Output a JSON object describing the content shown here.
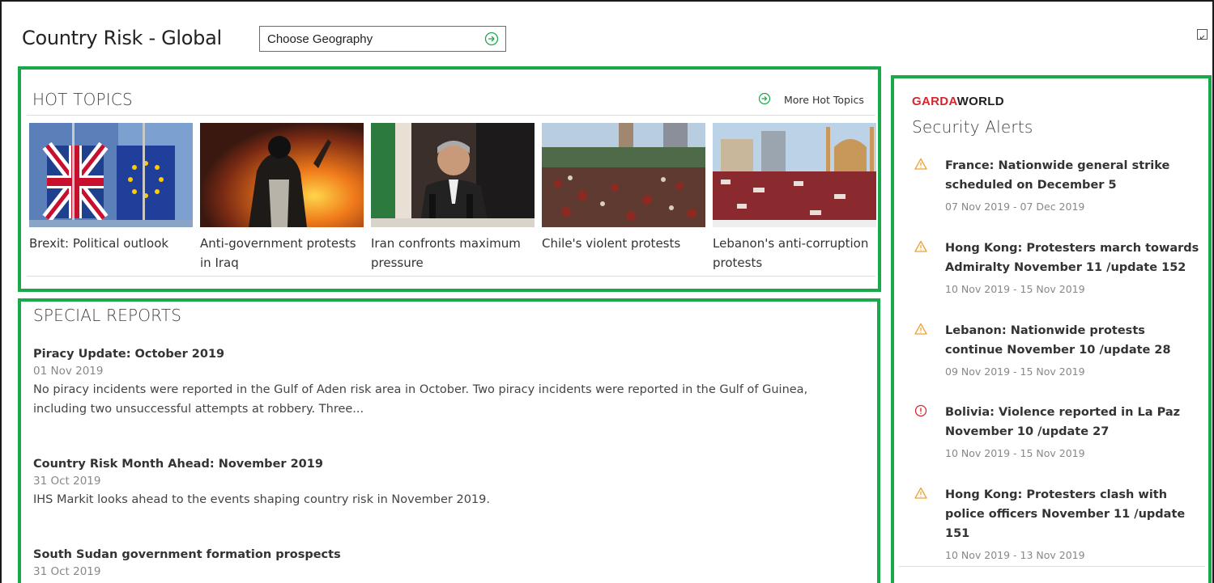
{
  "header": {
    "title": "Country Risk - Global",
    "geography_select": "Choose Geography"
  },
  "hot_topics": {
    "title": "HOT TOPICS",
    "more_link": "More Hot Topics",
    "items": [
      {
        "caption": "Brexit: Political outlook",
        "image": "uk-eu-flags"
      },
      {
        "caption": "Anti-government protests in Iraq",
        "image": "protester-with-fire"
      },
      {
        "caption": "Iran confronts maximum pressure",
        "image": "speaker-at-podium"
      },
      {
        "caption": "Chile's violent protests",
        "image": "crowd-in-plaza"
      },
      {
        "caption": "Lebanon's anti-corruption protests",
        "image": "crowd-with-mosque"
      }
    ]
  },
  "special_reports": {
    "title": "SPECIAL REPORTS",
    "items": [
      {
        "title": "Piracy Update: October 2019",
        "date": "01 Nov 2019",
        "summary": "No piracy incidents were reported in the Gulf of Aden risk area in October. Two piracy incidents were reported in the Gulf of Guinea, including two unsuccessful attempts at robbery. Three..."
      },
      {
        "title": "Country Risk Month Ahead: November 2019",
        "date": "31 Oct 2019",
        "summary": "IHS Markit looks ahead to the events shaping country risk in November 2019."
      },
      {
        "title": "South Sudan government formation prospects",
        "date": "31 Oct 2019",
        "summary": ""
      }
    ]
  },
  "security_alerts": {
    "logo_part1": "GARDA",
    "logo_part2": "WORLD",
    "title": "Security Alerts",
    "items": [
      {
        "title": "France: Nationwide general strike scheduled on December 5",
        "dates": "07 Nov 2019 - 07 Dec 2019",
        "severity": "warning"
      },
      {
        "title": "Hong Kong: Protesters march towards Admiralty November 11 /update 152",
        "dates": "10 Nov 2019 - 15 Nov 2019",
        "severity": "warning"
      },
      {
        "title": "Lebanon: Nationwide protests continue November 10 /update 28",
        "dates": "09 Nov 2019 - 15 Nov 2019",
        "severity": "warning"
      },
      {
        "title": "Bolivia: Violence reported in La Paz November 10 /update 27",
        "dates": "10 Nov 2019 - 15 Nov 2019",
        "severity": "critical"
      },
      {
        "title": "Hong Kong: Protesters clash with police officers November 11 /update 151",
        "dates": "10 Nov 2019 - 13 Nov 2019",
        "severity": "warning"
      }
    ]
  },
  "colors": {
    "highlight_border": "#19a84a",
    "warning_icon": "#f0a030",
    "critical_icon": "#d6262e",
    "garda_red": "#d6262e"
  }
}
